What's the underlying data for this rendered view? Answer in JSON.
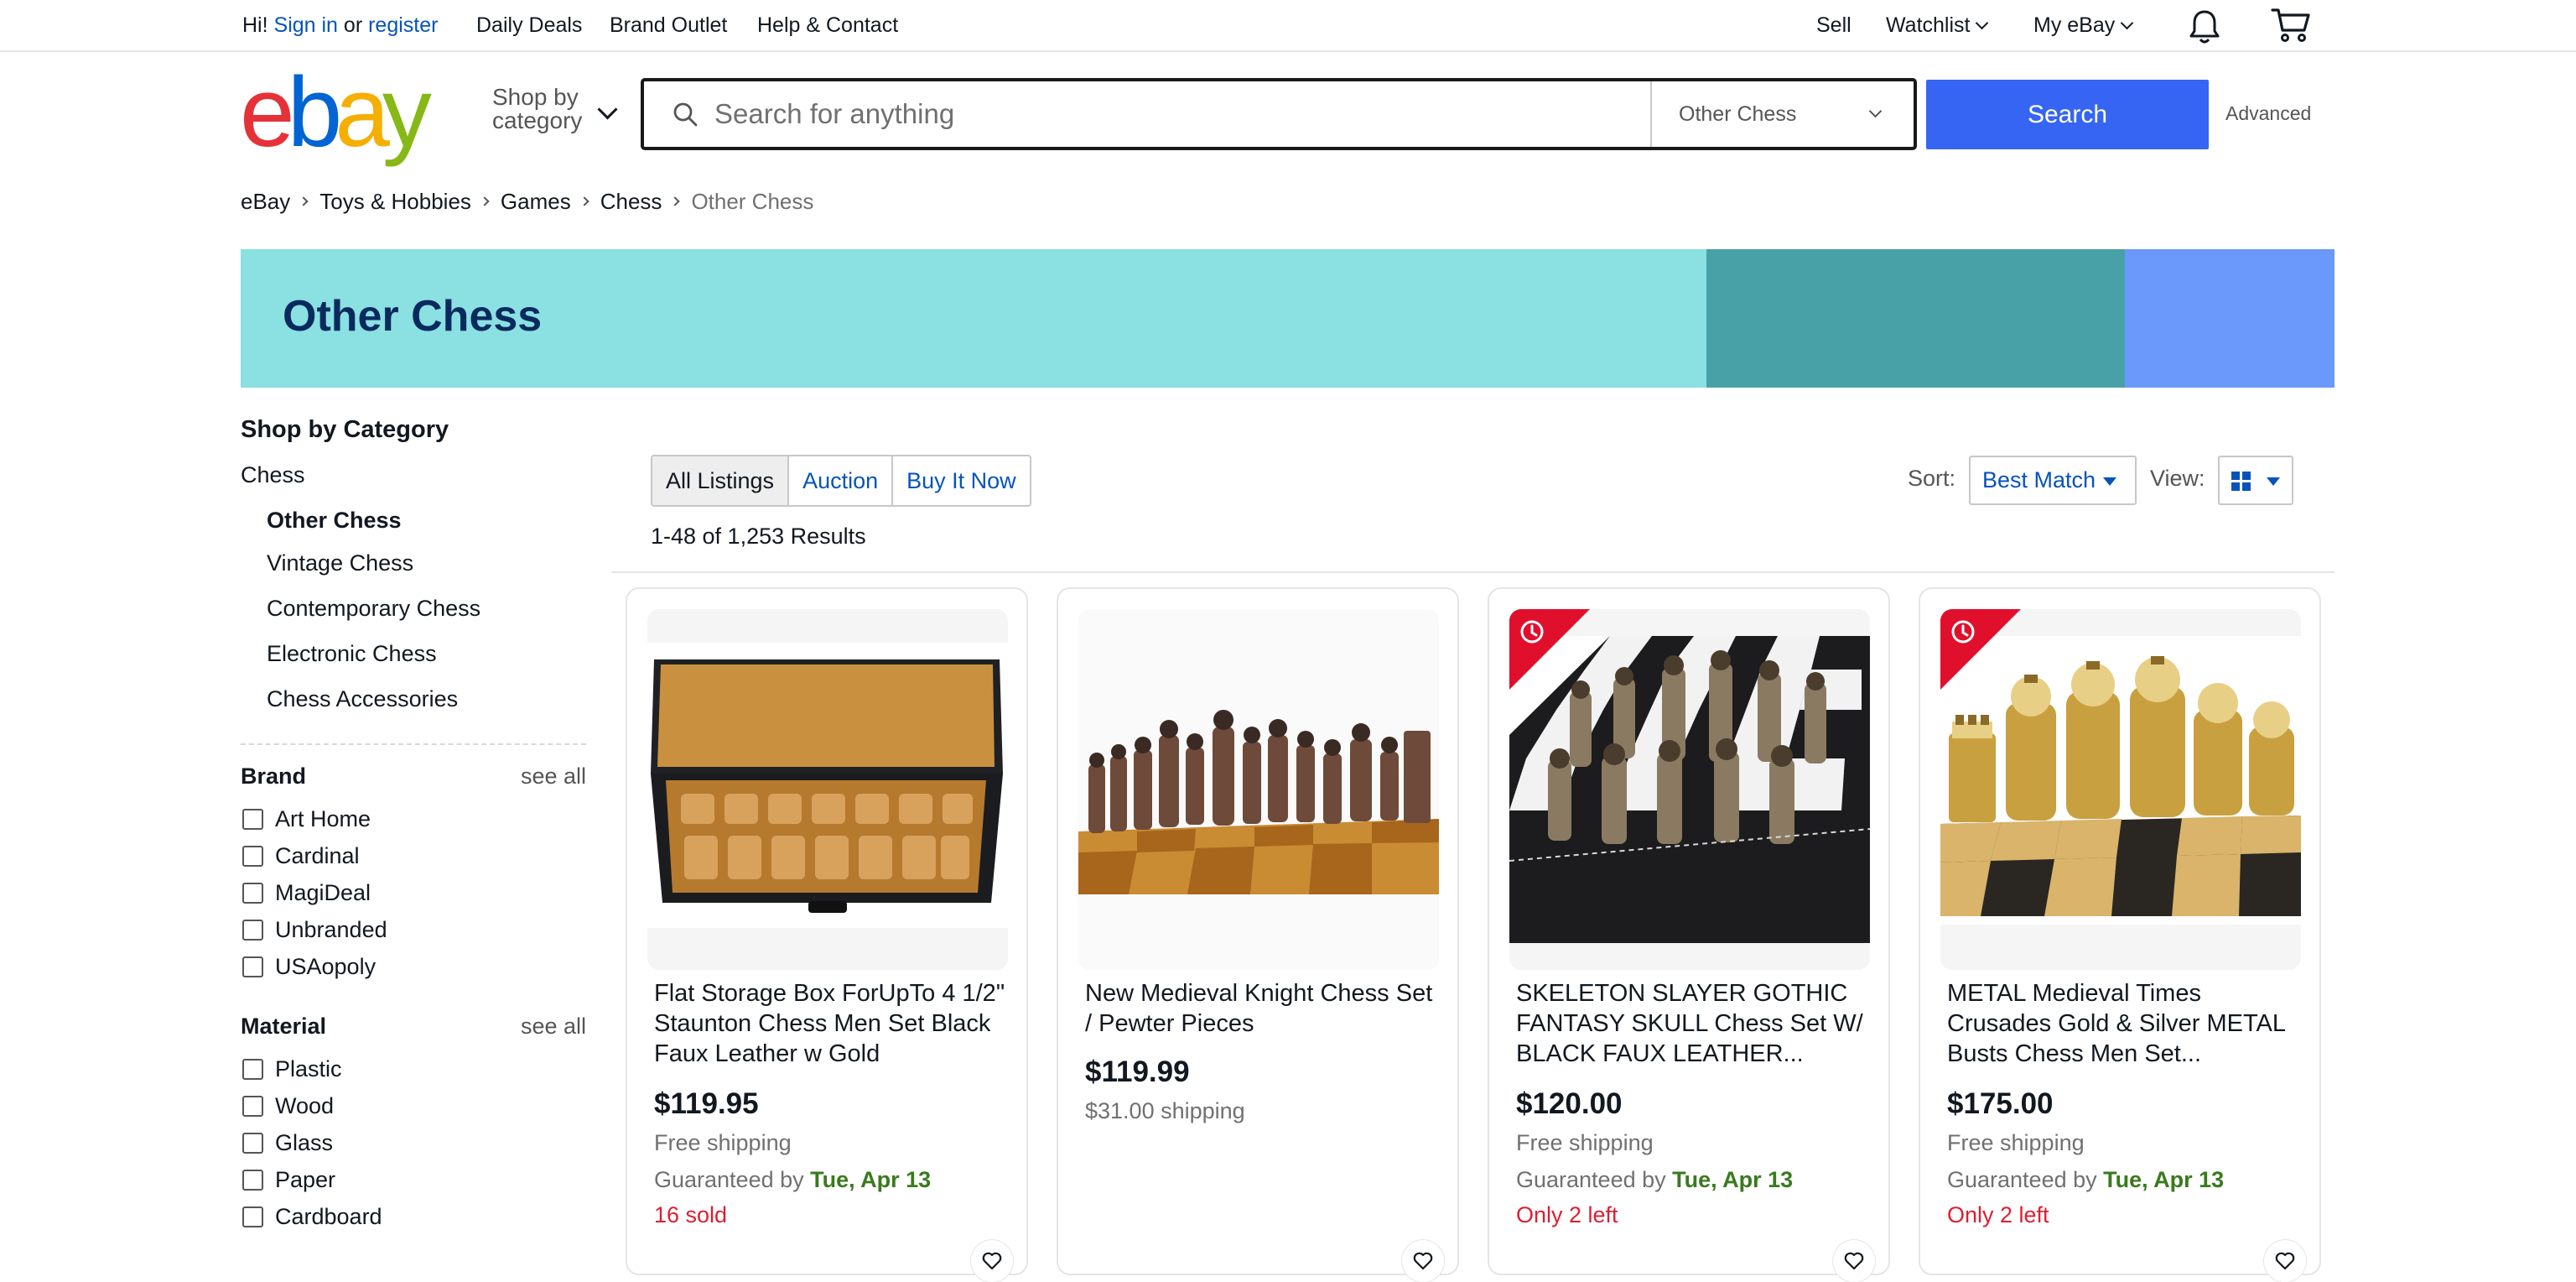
{
  "topbar": {
    "greeting": "Hi!",
    "sign_in": "Sign in",
    "or": "or",
    "register": "register",
    "daily_deals": "Daily Deals",
    "brand_outlet": "Brand Outlet",
    "help": "Help & Contact",
    "sell": "Sell",
    "watchlist": "Watchlist",
    "my_ebay": "My eBay"
  },
  "header": {
    "logo": [
      "e",
      "b",
      "a",
      "y"
    ],
    "shop_by_line1": "Shop by",
    "shop_by_line2": "category",
    "search_placeholder": "Search for anything",
    "search_category": "Other Chess",
    "search_button": "Search",
    "advanced": "Advanced"
  },
  "breadcrumb": [
    "eBay",
    "Toys & Hobbies",
    "Games",
    "Chess",
    "Other Chess"
  ],
  "banner": {
    "title": "Other Chess"
  },
  "sidebar": {
    "heading": "Shop by Category",
    "parent": "Chess",
    "categories": [
      "Other Chess",
      "Vintage Chess",
      "Contemporary Chess",
      "Electronic Chess",
      "Chess Accessories"
    ],
    "facets": [
      {
        "title": "Brand",
        "see_all": "see all",
        "options": [
          "Art Home",
          "Cardinal",
          "MagiDeal",
          "Unbranded",
          "USAopoly"
        ]
      },
      {
        "title": "Material",
        "see_all": "see all",
        "options": [
          "Plastic",
          "Wood",
          "Glass",
          "Paper",
          "Cardboard"
        ]
      }
    ]
  },
  "results": {
    "tabs": [
      "All Listings",
      "Auction",
      "Buy It Now"
    ],
    "count": "1-48 of 1,253 Results",
    "sort_label": "Sort:",
    "sort_value": "Best Match",
    "view_label": "View:"
  },
  "listings": [
    {
      "title": "Flat Storage Box ForUpTo 4 1/2\" Staunton Chess Men Set Black Faux Leather w Gold",
      "price": "$119.95",
      "shipping": "Free shipping",
      "guaranteed": "Guaranteed by",
      "date": "Tue, Apr 13",
      "note": "16 sold"
    },
    {
      "title": "New Medieval Knight Chess Set / Pewter Pieces",
      "price": "$119.99",
      "shipping": "$31.00 shipping"
    },
    {
      "title": "SKELETON SLAYER GOTHIC FANTASY SKULL Chess Set W/ BLACK FAUX LEATHER...",
      "price": "$120.00",
      "shipping": "Free shipping",
      "guaranteed": "Guaranteed by",
      "date": "Tue, Apr 13",
      "note": "Only 2 left"
    },
    {
      "title": "METAL Medieval Times Crusades Gold & Silver METAL Busts Chess Men Set...",
      "price": "$175.00",
      "shipping": "Free shipping",
      "guaranteed": "Guaranteed by",
      "date": "Tue, Apr 13",
      "note": "Only 2 left"
    }
  ],
  "colors": {
    "link_blue": "#0654ba",
    "search_button": "#3665f3",
    "banner_light": "#8be0e2",
    "banner_mid": "#48a1a7",
    "banner_right": "#6a98fb",
    "banner_title": "#0a2a5e",
    "guarantee_green": "#3a7a1e",
    "alert_red": "#dd1e31",
    "logo": [
      "#e53238",
      "#0064d2",
      "#f5af02",
      "#86b817"
    ]
  }
}
